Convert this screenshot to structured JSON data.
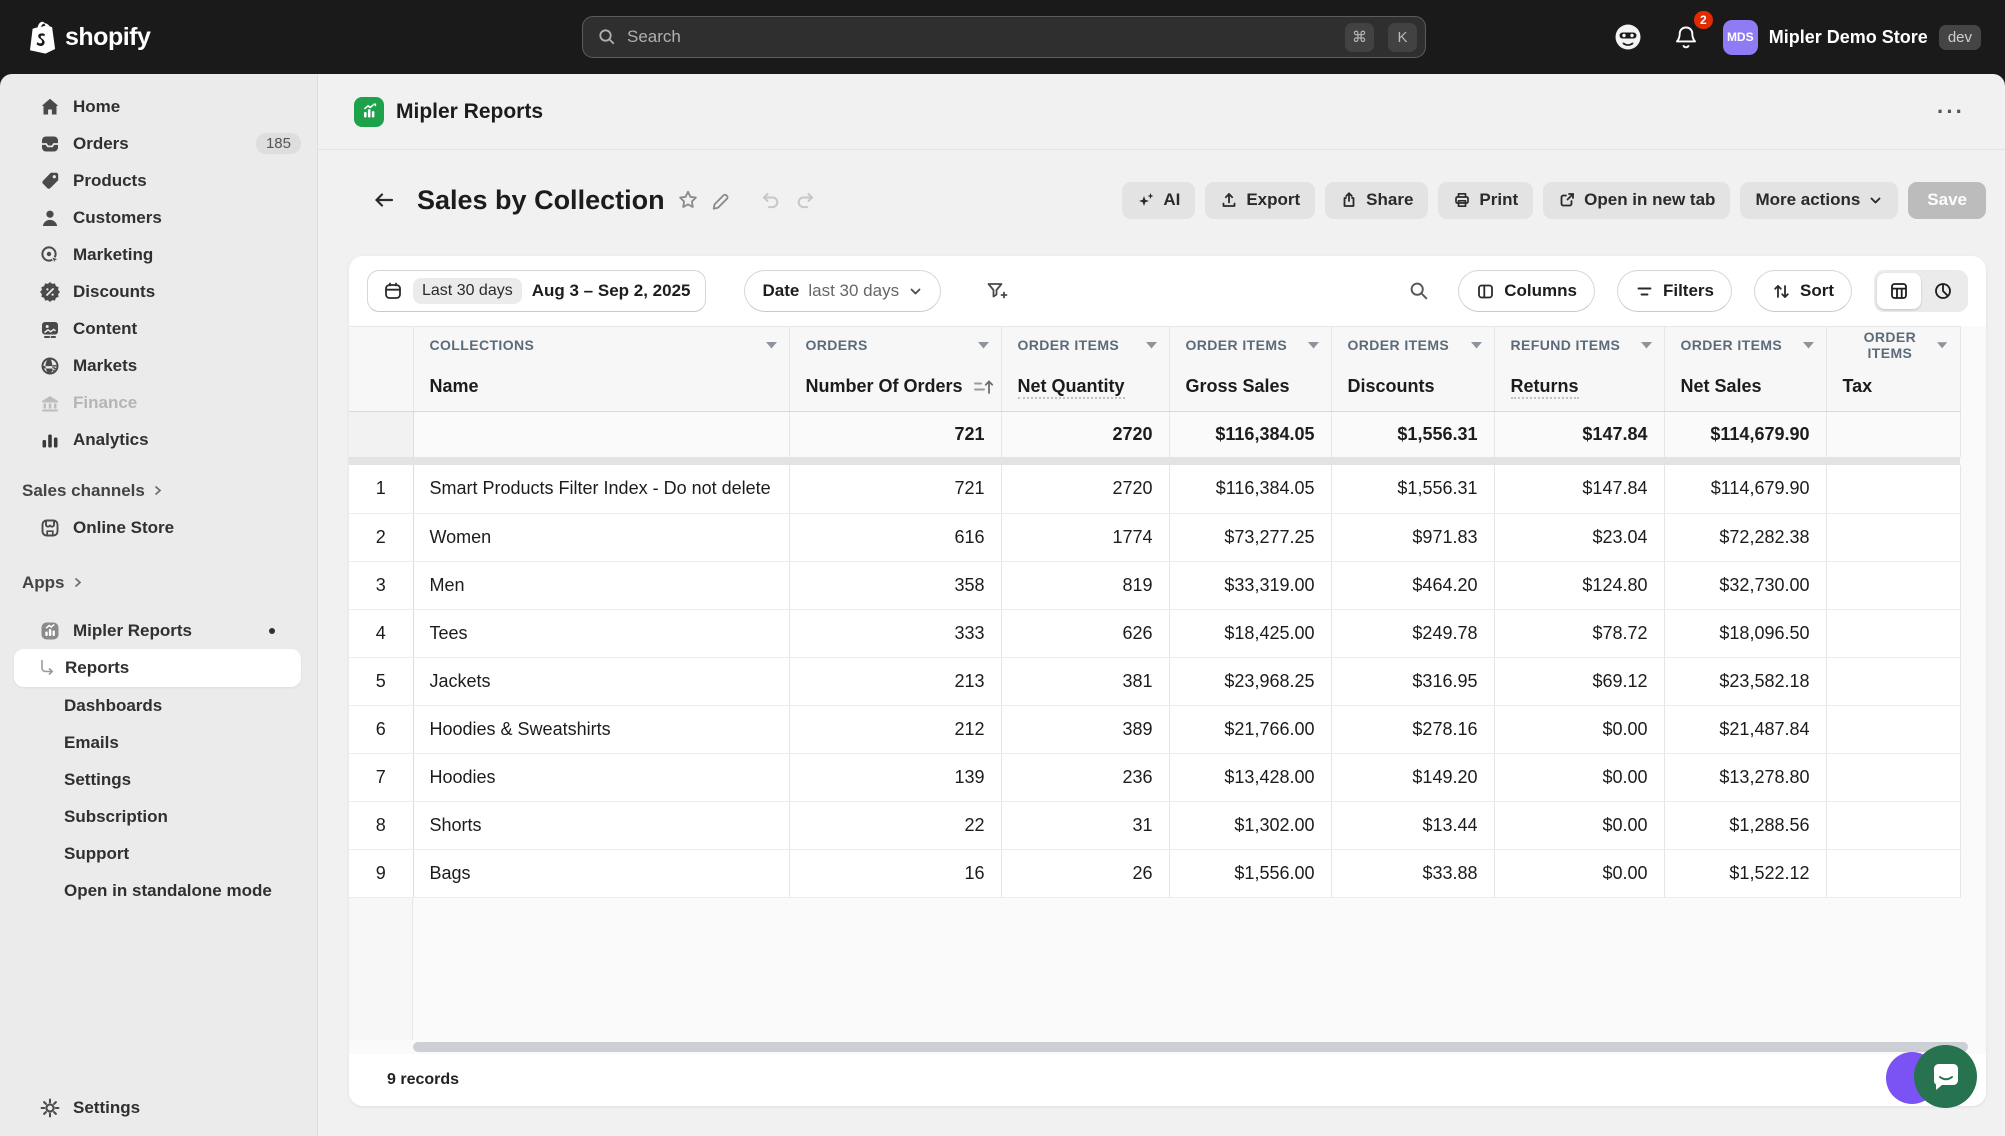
{
  "topbar": {
    "logo_text": "shopify",
    "search_placeholder": "Search",
    "key_cmd": "⌘",
    "key_k": "K",
    "notification_count": "2",
    "avatar_initials": "MDS",
    "store_name": "Mipler Demo Store",
    "env_badge": "dev"
  },
  "sidebar": {
    "items": [
      {
        "label": "Home"
      },
      {
        "label": "Orders",
        "badge": "185"
      },
      {
        "label": "Products"
      },
      {
        "label": "Customers"
      },
      {
        "label": "Marketing"
      },
      {
        "label": "Discounts"
      },
      {
        "label": "Content"
      },
      {
        "label": "Markets"
      },
      {
        "label": "Finance"
      },
      {
        "label": "Analytics"
      }
    ],
    "sales_channels_label": "Sales channels",
    "online_store_label": "Online Store",
    "apps_label": "Apps",
    "app_name": "Mipler Reports",
    "app_items": [
      "Reports",
      "Dashboards",
      "Emails",
      "Settings",
      "Subscription",
      "Support",
      "Open in standalone mode"
    ],
    "settings_label": "Settings"
  },
  "header": {
    "app_title": "Mipler Reports"
  },
  "report": {
    "title": "Sales by Collection",
    "actions": {
      "ai": "AI",
      "export": "Export",
      "share": "Share",
      "print": "Print",
      "open_new_tab": "Open in new tab",
      "more_actions": "More actions",
      "save": "Save"
    }
  },
  "filterbar": {
    "date_chip": "Last 30 days",
    "date_range": "Aug 3 – Sep 2, 2025",
    "dimension_label": "Date",
    "dimension_value": "last 30 days",
    "columns_label": "Columns",
    "filters_label": "Filters",
    "sort_label": "Sort"
  },
  "table": {
    "groups": [
      "COLLECTIONS",
      "ORDERS",
      "ORDER ITEMS",
      "ORDER ITEMS",
      "ORDER ITEMS",
      "REFUND ITEMS",
      "ORDER ITEMS",
      "ORDER ITEMS"
    ],
    "columns": [
      "Name",
      "Number Of Orders",
      "Net Quantity",
      "Gross Sales",
      "Discounts",
      "Returns",
      "Net Sales",
      "Tax"
    ],
    "totals": [
      "721",
      "2720",
      "$116,384.05",
      "$1,556.31",
      "$147.84",
      "$114,679.90",
      ""
    ],
    "rows": [
      {
        "num": "1",
        "name": "Smart Products Filter Index - Do not delete",
        "values": [
          "721",
          "2720",
          "$116,384.05",
          "$1,556.31",
          "$147.84",
          "$114,679.90",
          ""
        ]
      },
      {
        "num": "2",
        "name": "Women",
        "values": [
          "616",
          "1774",
          "$73,277.25",
          "$971.83",
          "$23.04",
          "$72,282.38",
          ""
        ]
      },
      {
        "num": "3",
        "name": "Men",
        "values": [
          "358",
          "819",
          "$33,319.00",
          "$464.20",
          "$124.80",
          "$32,730.00",
          ""
        ]
      },
      {
        "num": "4",
        "name": "Tees",
        "values": [
          "333",
          "626",
          "$18,425.00",
          "$249.78",
          "$78.72",
          "$18,096.50",
          ""
        ]
      },
      {
        "num": "5",
        "name": "Jackets",
        "values": [
          "213",
          "381",
          "$23,968.25",
          "$316.95",
          "$69.12",
          "$23,582.18",
          ""
        ]
      },
      {
        "num": "6",
        "name": "Hoodies & Sweatshirts",
        "values": [
          "212",
          "389",
          "$21,766.00",
          "$278.16",
          "$0.00",
          "$21,487.84",
          ""
        ]
      },
      {
        "num": "7",
        "name": "Hoodies",
        "values": [
          "139",
          "236",
          "$13,428.00",
          "$149.20",
          "$0.00",
          "$13,278.80",
          ""
        ]
      },
      {
        "num": "8",
        "name": "Shorts",
        "values": [
          "22",
          "31",
          "$1,302.00",
          "$13.44",
          "$0.00",
          "$1,288.56",
          ""
        ]
      },
      {
        "num": "9",
        "name": "Bags",
        "values": [
          "16",
          "26",
          "$1,556.00",
          "$33.88",
          "$0.00",
          "$1,522.12",
          ""
        ]
      }
    ],
    "records_label": "9 records"
  },
  "colors": {
    "app_green": "#1ea14b",
    "avatar_purple": "#8f7bf3",
    "notification_red": "#e02b00",
    "chat_green": "#27734f",
    "chat_purple": "#7b52f4"
  }
}
